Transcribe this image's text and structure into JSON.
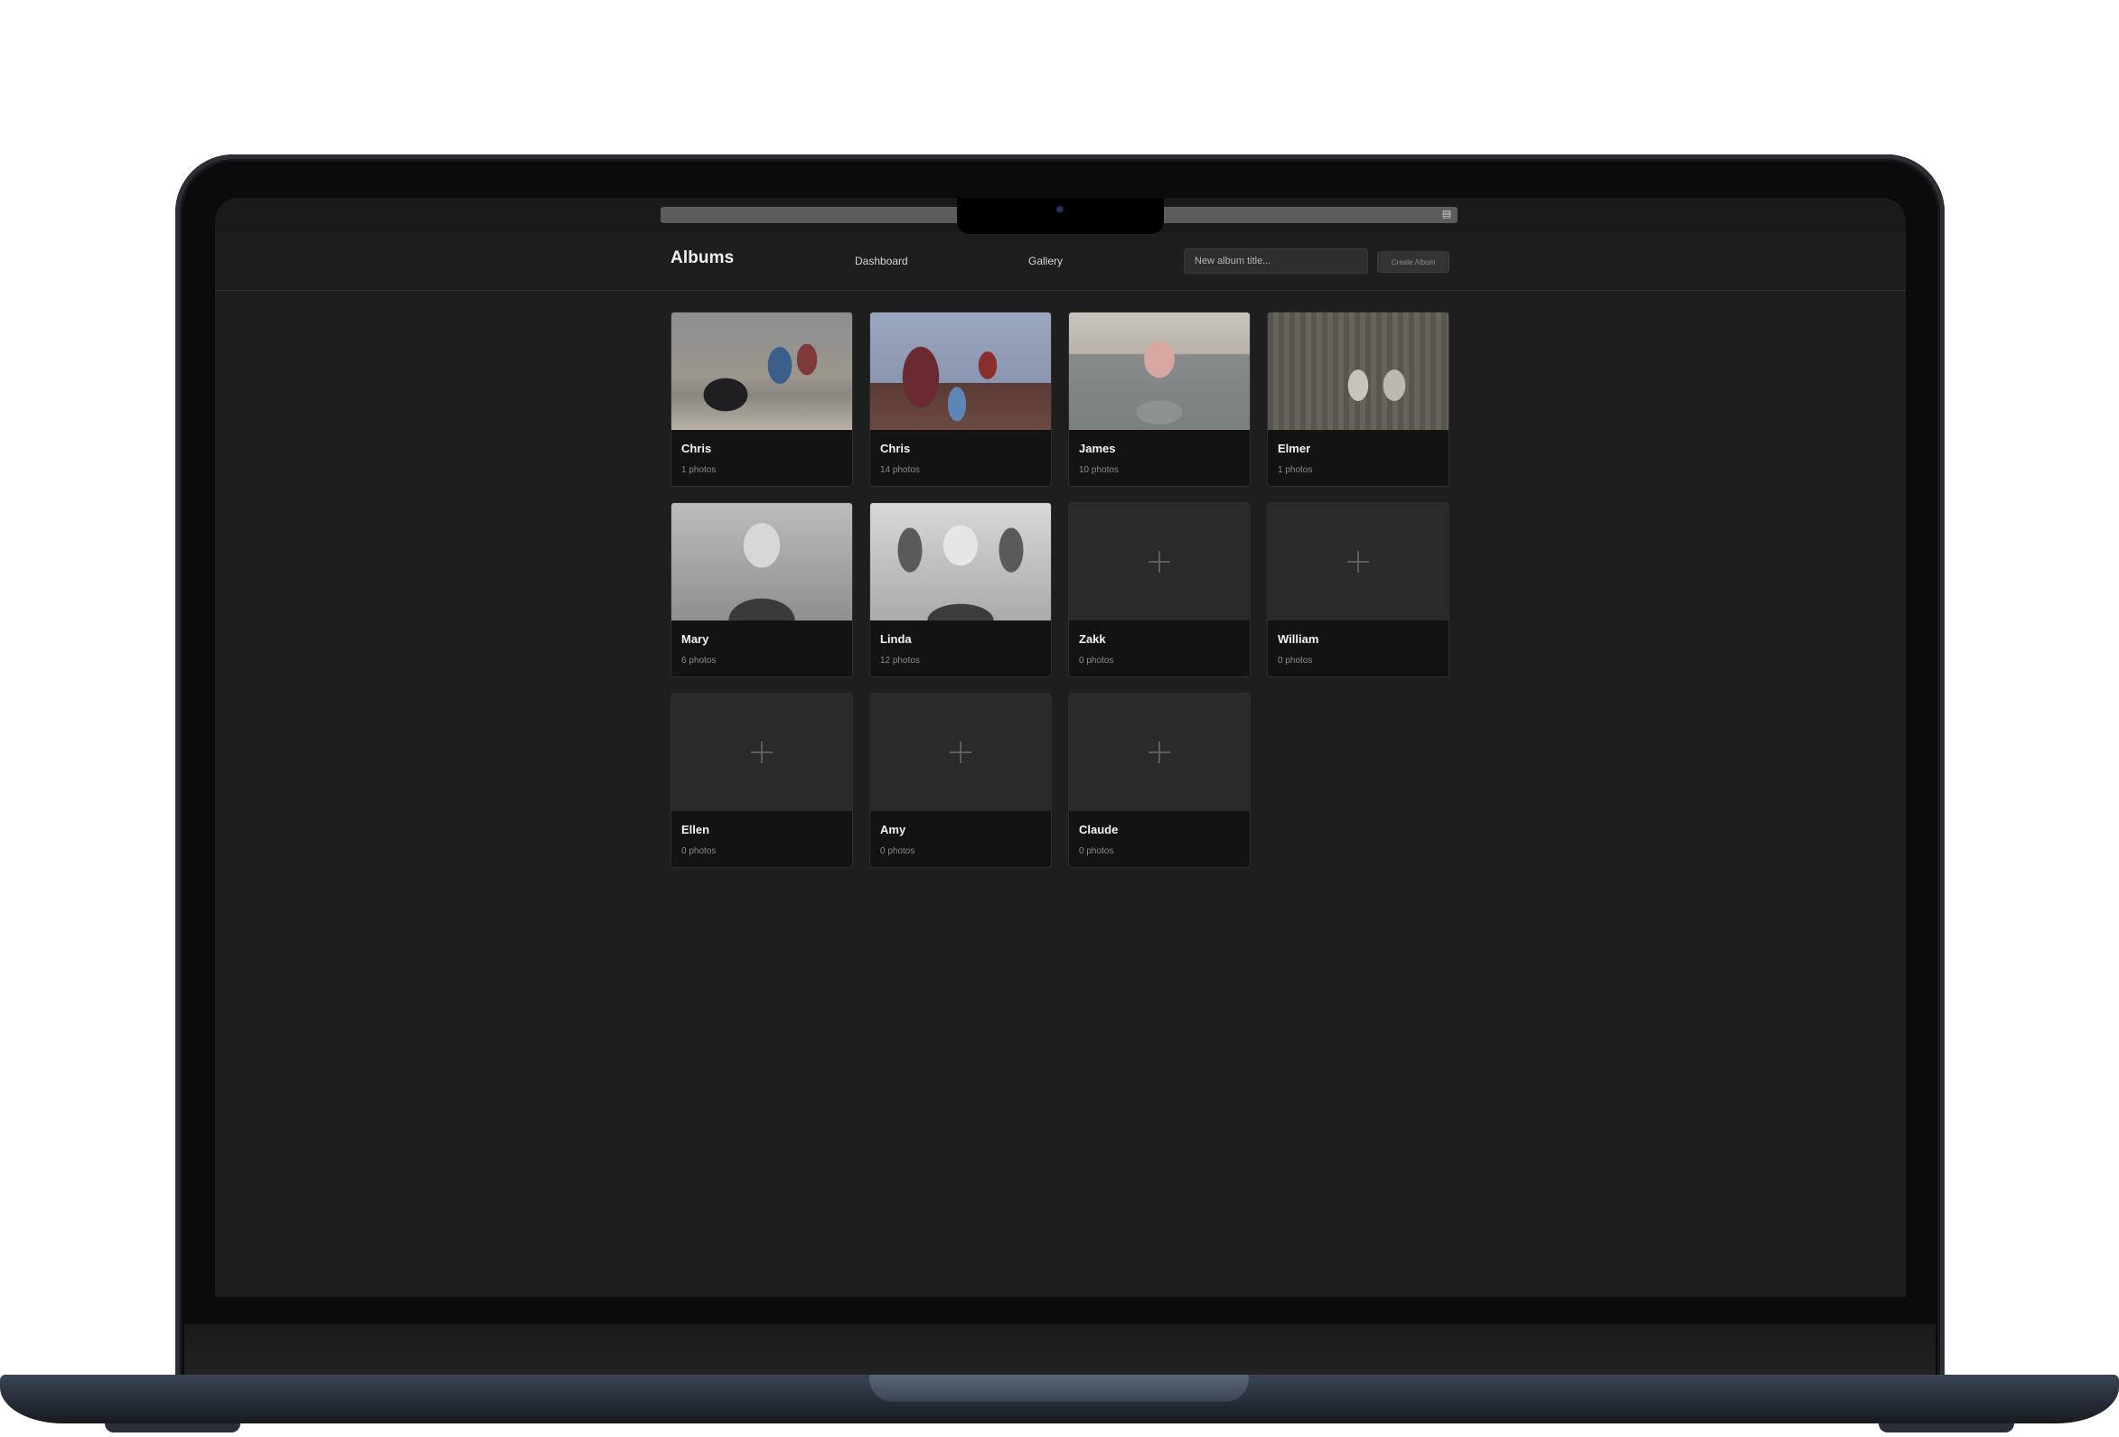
{
  "app": {
    "brand": "Albums",
    "nav": [
      {
        "label": "Dashboard"
      },
      {
        "label": "Gallery"
      }
    ],
    "new_album": {
      "placeholder": "New album title...",
      "value": "",
      "button_label": "Create Album"
    }
  },
  "albums": [
    {
      "title": "Chris",
      "count": "1 photos",
      "has_photo": true
    },
    {
      "title": "Chris",
      "count": "14 photos",
      "has_photo": true
    },
    {
      "title": "James",
      "count": "10 photos",
      "has_photo": true
    },
    {
      "title": "Elmer",
      "count": "1 photos",
      "has_photo": true
    },
    {
      "title": "Mary",
      "count": "6 photos",
      "has_photo": true
    },
    {
      "title": "Linda",
      "count": "12 photos",
      "has_photo": true
    },
    {
      "title": "Zakk",
      "count": "0 photos",
      "has_photo": false,
      "icon": "plus-icon"
    },
    {
      "title": "William",
      "count": "0 photos",
      "has_photo": false,
      "icon": "plus-icon"
    },
    {
      "title": "Ellen",
      "count": "0 photos",
      "has_photo": false,
      "icon": "plus-icon"
    },
    {
      "title": "Amy",
      "count": "0 photos",
      "has_photo": false,
      "icon": "plus-icon"
    },
    {
      "title": "Claude",
      "count": "0 photos",
      "has_photo": false,
      "icon": "plus-icon"
    }
  ]
}
